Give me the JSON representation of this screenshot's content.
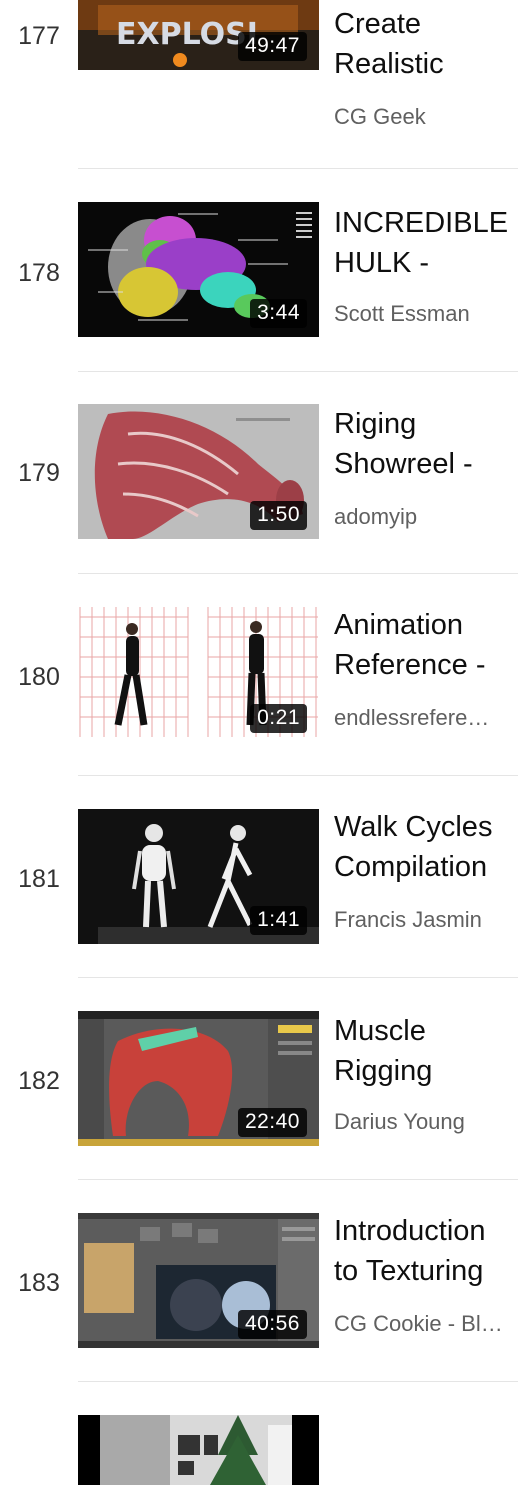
{
  "playlist": {
    "items": [
      {
        "index": "177",
        "duration": "49:47",
        "title_line1": "Create",
        "title_line2": "Realistic",
        "channel": "CG Geek"
      },
      {
        "index": "178",
        "duration": "3:44",
        "title_line1": "INCREDIBLE",
        "title_line2": "HULK -",
        "channel": "Scott Essman"
      },
      {
        "index": "179",
        "duration": "1:50",
        "title_line1": "Riging",
        "title_line2": "Showreel -",
        "channel": "adomyip"
      },
      {
        "index": "180",
        "duration": "0:21",
        "title_line1": "Animation",
        "title_line2": "Reference -",
        "channel": "endlessrefere…"
      },
      {
        "index": "181",
        "duration": "1:41",
        "title_line1": "Walk Cycles",
        "title_line2": "Compilation",
        "channel": "Francis Jasmin"
      },
      {
        "index": "182",
        "duration": "22:40",
        "title_line1": "Muscle",
        "title_line2": "Rigging",
        "channel": "Darius Young"
      },
      {
        "index": "183",
        "duration": "40:56",
        "title_line1": "Introduction",
        "title_line2": "to Texturing",
        "channel": "CG Cookie - Bl…"
      }
    ]
  },
  "colors": {
    "title": "#0f0f0f",
    "channel": "#606060",
    "separator": "#e5e5e5"
  }
}
